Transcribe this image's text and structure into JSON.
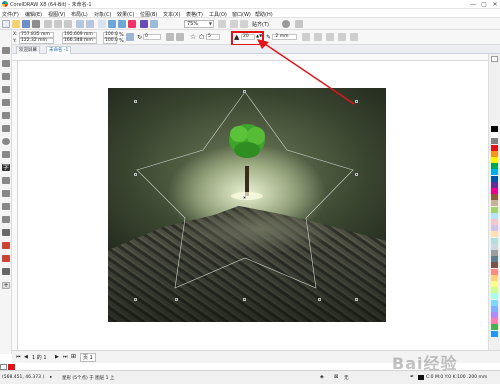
{
  "titlebar": {
    "title": "CorelDRAW X8 (64-Bit) - 未命名-1",
    "minimize": "—",
    "maximize": "▢",
    "close": "✕"
  },
  "menubar": {
    "items": [
      "文件(F)",
      "编辑(E)",
      "视图(V)",
      "布局(L)",
      "对象(C)",
      "效果(C)",
      "位图(B)",
      "文本(X)",
      "表格(T)",
      "工具(O)",
      "窗口(W)",
      "帮助(H)"
    ]
  },
  "stdbar": {
    "zoom": "75%",
    "snap_label": "贴齐(T)"
  },
  "propbar": {
    "x": "757.835 mm",
    "y": "122.32 mm",
    "width": "195.609 mm",
    "height": "166.348 mm",
    "scale_w": "100.0",
    "scale_h": "100.0",
    "percent": "%",
    "rotation": "0",
    "points": "5",
    "sharpness": "20",
    "outline": ".2 mm"
  },
  "tabs": [
    {
      "label": "欢迎屏幕",
      "active": false
    },
    {
      "label": "未命名 -1",
      "active": true
    }
  ],
  "pagebar": {
    "page_count": "1 的 1",
    "page_tab": "页 1"
  },
  "statusbar": {
    "coords": "(568.451, 46.373 )",
    "info": "星形 (5个点) 于 图层 1 上",
    "fill_none": "无",
    "outline_info": "C:0 M:0 Y:0 K:100 .200 mm"
  },
  "watermark": "Bai经验",
  "colors": {
    "highlight": "#e3131b",
    "arrow": "#e3131b",
    "accent": "#1463b5",
    "palette": [
      "#000000",
      "#ffffff",
      "#7f7f7f",
      "#e3131b",
      "#f7941d",
      "#fff200",
      "#00a651",
      "#00aeef",
      "#0054a6",
      "#662d91",
      "#ec008c",
      "#8b5e3c",
      "#c7b299",
      "#a0d468",
      "#b3e5fc",
      "#f5c6cb",
      "#d1c4e9",
      "#ffe0b2",
      "#b2dfdb",
      "#cfd8dc",
      "#9e9e9e",
      "#607d8b",
      "#795548",
      "#ff8a80",
      "#ffd180",
      "#ffff8d",
      "#ccff90",
      "#a7ffeb",
      "#80d8ff",
      "#82b1ff",
      "#b388ff",
      "#ff80ab",
      "#4caf50",
      "#2196f3"
    ]
  },
  "icons": [
    "app-icon",
    "new-icon",
    "open-icon",
    "save-icon",
    "print-icon",
    "undo-icon",
    "redo-icon",
    "import-icon",
    "export-icon",
    "zoom-icon",
    "gear-icon",
    "pick-tool-icon",
    "shape-tool-icon",
    "crop-tool-icon",
    "zoom-tool-icon",
    "freehand-tool-icon",
    "rectangle-tool-icon",
    "ellipse-tool-icon",
    "polygon-tool-icon",
    "text-tool-icon",
    "dimension-tool-icon",
    "connector-tool-icon",
    "shadow-tool-icon",
    "transparency-tool-icon",
    "eyedropper-tool-icon",
    "fill-tool-icon",
    "outline-tool-icon",
    "star-icon",
    "lock-icon"
  ]
}
